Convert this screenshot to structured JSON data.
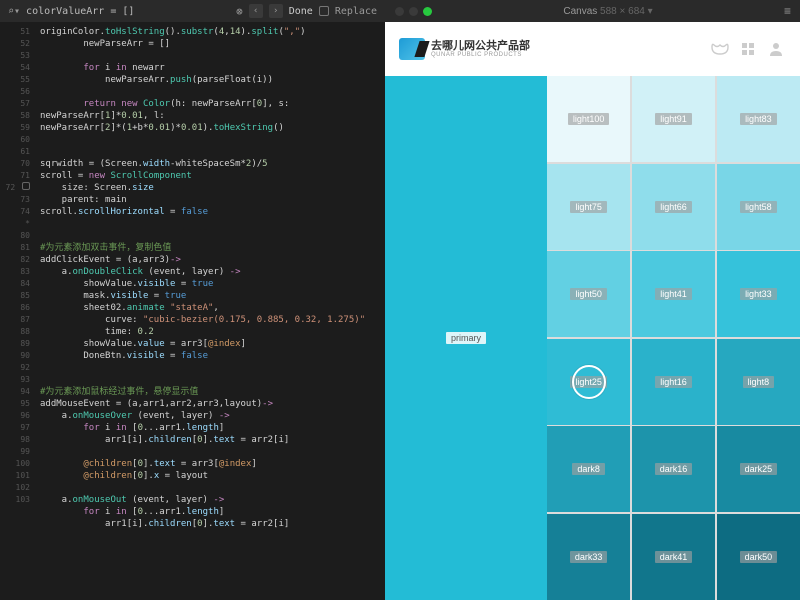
{
  "editor": {
    "search_text": "colorValueArr = []",
    "done": "Done",
    "replace": "Replace",
    "line_start": 51,
    "gutter": [
      "51",
      "52",
      "53",
      "54",
      "55",
      "56",
      "57",
      "58",
      "",
      "59",
      "60",
      "61",
      "",
      "",
      "70",
      "71",
      "72",
      "73",
      "74",
      "*",
      "",
      "",
      "",
      "80",
      "81",
      "82",
      "83",
      "84",
      "85",
      "86",
      "87",
      "88",
      "89",
      "90",
      "",
      "",
      "92",
      "93",
      "94",
      "95",
      "96",
      "97",
      "",
      "98",
      "99",
      "100",
      "",
      "101",
      "102",
      "103"
    ]
  },
  "code": {
    "l1a": "originColor.",
    "l1b": "toHslString",
    "l1c": "().",
    "l1d": "substr",
    "l1e": "(",
    "l1f": "4",
    "l1g": ",",
    "l1h": "14",
    "l1i": ").",
    "l1j": "split",
    "l1k": "(",
    "l1l": "\",\"",
    "l1m": ")",
    "l2": "        newParseArr = []",
    "l4a": "        ",
    "l4b": "for",
    "l4c": " i ",
    "l4d": "in",
    "l4e": " newarr",
    "l5a": "            newParseArr.",
    "l5b": "push",
    "l5c": "(parseFloat(i))",
    "l7a": "        ",
    "l7b": "return",
    "l7c": " ",
    "l7d": "new",
    "l7e": " ",
    "l7f": "Color",
    "l7g": "(h: newParseArr[",
    "l7h": "0",
    "l7i": "], s:",
    "l8a": "newParseArr[",
    "l8b": "1",
    "l8c": "]*",
    "l8d": "0.01",
    "l8e": ", l:",
    "l9a": "newParseArr[",
    "l9b": "2",
    "l9c": "]*(",
    "l9d": "1",
    "l9e": "+b*",
    "l9f": "0.01",
    "l9g": ")*",
    "l9h": "0.01",
    "l9i": ").",
    "l9j": "toHexString",
    "l9k": "()",
    "l12a": "sqrwidth = (Screen.",
    "l12b": "width",
    "l12c": "-whiteSpaceSm*",
    "l12d": "2",
    "l12e": ")/",
    "l12f": "5",
    "l13a": "scroll = ",
    "l13b": "new",
    "l13c": " ",
    "l13d": "ScrollComponent",
    "l14a": "    size: Screen.",
    "l14b": "size",
    "l15": "    parent: main",
    "l16a": "scroll.",
    "l16b": "scrollHorizontal",
    "l16c": " = ",
    "l16d": "false",
    "c1": "#为元素添加双击事件，复制色值",
    "l20a": "addClickEvent = (a,arr3)",
    "l20b": "->",
    "l21a": "    a.",
    "l21b": "onDoubleClick",
    "l21c": " (event, layer) ",
    "l21d": "->",
    "l22a": "        showValue.",
    "l22b": "visible",
    "l22c": " = ",
    "l22d": "true",
    "l23a": "        mask.",
    "l23b": "visible",
    "l23c": " = ",
    "l23d": "true",
    "l24a": "        sheet02.",
    "l24b": "animate",
    "l24c": " ",
    "l24d": "\"stateA\"",
    "l24e": ",",
    "l25a": "            curve: ",
    "l25b": "\"cubic-bezier(0.175, 0.885, 0.32, 1.275)\"",
    "l26a": "            time: ",
    "l26b": "0.2",
    "l27a": "        showValue.",
    "l27b": "value",
    "l27c": " = arr3[",
    "l27d": "@index",
    "l27e": "]",
    "l28a": "        DoneBtn.",
    "l28b": "visible",
    "l28c": " = ",
    "l28d": "false",
    "c2": "#为元素添加鼠标经过事件，悬停显示值",
    "l31a": "addMouseEvent = (a,arr1,arr2,arr3,layout)",
    "l31b": "->",
    "l32a": "    a.",
    "l32b": "onMouseOver",
    "l32c": " (event, layer) ",
    "l32d": "->",
    "l33a": "        ",
    "l33b": "for",
    "l33c": " i ",
    "l33d": "in",
    "l33e": " [",
    "l33f": "0",
    "l33g": "...arr1.",
    "l33h": "length",
    "l33i": "]",
    "l34a": "            arr1[i].",
    "l34b": "children",
    "l34c": "[",
    "l34d": "0",
    "l34e": "].",
    "l34f": "text",
    "l34g": " = arr2[i]",
    "l36a": "        ",
    "l36b": "@children",
    "l36c": "[",
    "l36d": "0",
    "l36e": "].",
    "l36f": "text",
    "l36g": " = arr3[",
    "l36h": "@index",
    "l36i": "]",
    "l37a": "        ",
    "l37b": "@children",
    "l37c": "[",
    "l37d": "0",
    "l37e": "].",
    "l37f": "x",
    "l37g": " = layout",
    "l39a": "    a.",
    "l39b": "onMouseOut",
    "l39c": " (event, layer) ",
    "l39d": "->",
    "l40a": "        ",
    "l40b": "for",
    "l40c": " i ",
    "l40d": "in",
    "l40e": " [",
    "l40f": "0",
    "l40g": "...arr1.",
    "l40h": "length",
    "l40i": "]",
    "l41a": "            arr1[i].",
    "l41b": "children",
    "l41c": "[",
    "l41d": "0",
    "l41e": "].",
    "l41f": "text",
    "l41g": " = arr2[i]"
  },
  "preview": {
    "canvas": "Canvas",
    "dims": "588 × 684",
    "brand_cn": "去哪儿网公共产品部",
    "brand_en": "QUNAR PUBLIC PRODUCTS",
    "primary": "primary",
    "swatches": [
      {
        "label": "light100",
        "bg": "#e9f8fb"
      },
      {
        "label": "light91",
        "bg": "#d1f1f7"
      },
      {
        "label": "light83",
        "bg": "#bceaf3"
      },
      {
        "label": "light75",
        "bg": "#a6e4ef"
      },
      {
        "label": "light66",
        "bg": "#8fddeb"
      },
      {
        "label": "light58",
        "bg": "#79d6e7"
      },
      {
        "label": "light50",
        "bg": "#62d0e3"
      },
      {
        "label": "light41",
        "bg": "#4cc9df"
      },
      {
        "label": "light33",
        "bg": "#35c2db"
      },
      {
        "label": "light25",
        "bg": "#2fbcd5",
        "selected": true
      },
      {
        "label": "light16",
        "bg": "#2ab2cb"
      },
      {
        "label": "light8",
        "bg": "#26a8c0"
      },
      {
        "label": "dark8",
        "bg": "#219eb6"
      },
      {
        "label": "dark16",
        "bg": "#1d94ab"
      },
      {
        "label": "dark25",
        "bg": "#188aa1"
      },
      {
        "label": "dark33",
        "bg": "#158097"
      },
      {
        "label": "dark41",
        "bg": "#11768c"
      },
      {
        "label": "dark50",
        "bg": "#0d6c82"
      }
    ]
  }
}
